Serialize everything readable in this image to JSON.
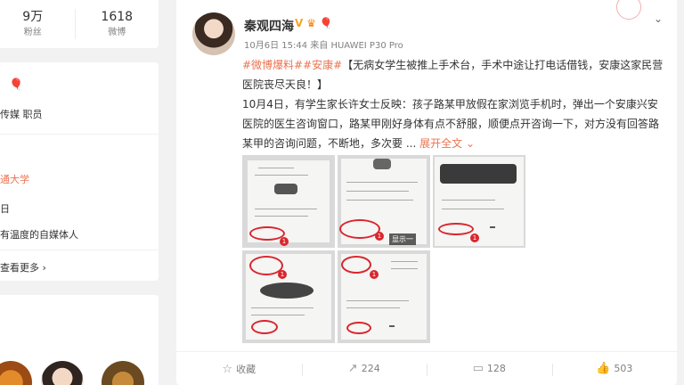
{
  "profile_stats": [
    {
      "value": "9万",
      "label": "粉丝"
    },
    {
      "value": "1618",
      "label": "微博"
    }
  ],
  "profile_info": {
    "industry": "传媒 职员",
    "school": "通大学",
    "ri": "日",
    "bio": "有温度的自媒体人",
    "see_more": "查看更多"
  },
  "post": {
    "author": "秦观四海",
    "badges": {
      "verified": "V"
    },
    "date": "10月6日 15:44",
    "source_prefix": "来自",
    "device": "HUAWEI P30 Pro",
    "tags": "#微博爆料##安康#",
    "headline": "【无病女学生被推上手术台，手术中途让打电话借钱，安康这家民营医院丧尽天良！】",
    "body": "10月4日，有学生家长许女士反映：孩子路某甲放假在家浏览手机时，弹出一个安康兴安医院的医生咨询窗口，路某甲刚好身体有点不舒服，顺便点开咨询一下，对方没有回答路某甲的咨询问题，不断地，多次要 ...",
    "expand": "展开全文",
    "image_captions": [
      "显示一",
      "显示一"
    ]
  },
  "actions": {
    "favorite": "收藏",
    "repost": "224",
    "comment": "128",
    "like": "503"
  },
  "colors": {
    "accent": "#eb7350",
    "background": "#f2f2f2"
  }
}
